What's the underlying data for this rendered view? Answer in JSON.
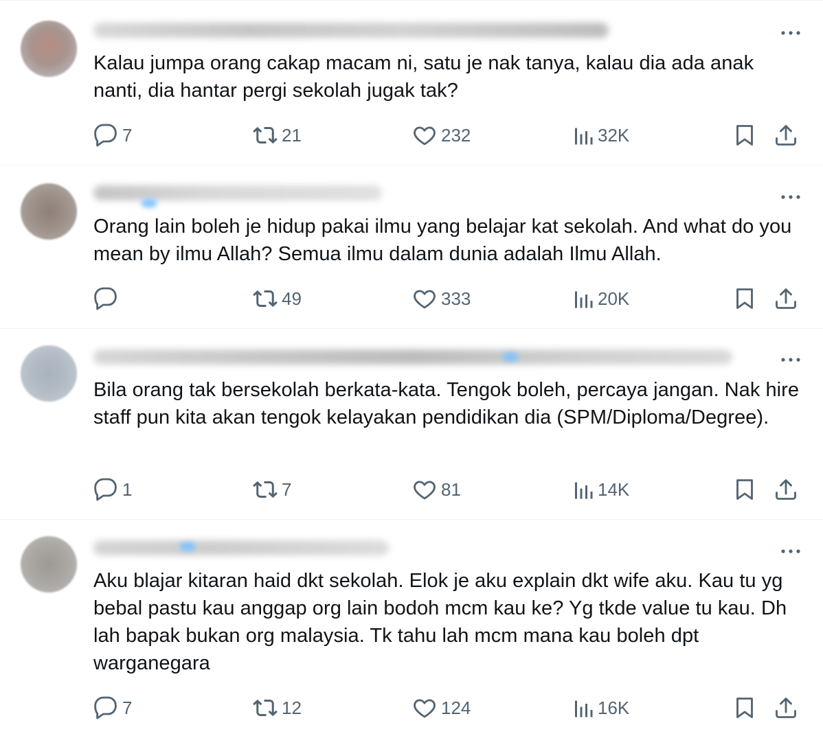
{
  "colors": {
    "text": "#0f1419",
    "secondary": "#536471",
    "divider": "#eff3f4"
  },
  "icons": {
    "reply": "reply-icon",
    "retweet": "retweet-icon",
    "like": "heart-icon",
    "views": "views-icon",
    "bookmark": "bookmark-icon",
    "share": "share-icon",
    "more": "more-icon"
  },
  "tweets": [
    {
      "text": "Kalau jumpa orang cakap macam ni, satu je nak tanya, kalau dia ada anak nanti, dia hantar pergi sekolah jugak tak?",
      "replies": "7",
      "retweets": "21",
      "likes": "232",
      "views": "32K"
    },
    {
      "text": "Orang lain boleh je hidup pakai ilmu yang belajar kat sekolah. And what do you mean by ilmu Allah? Semua ilmu dalam dunia adalah Ilmu Allah.",
      "replies": "",
      "retweets": "49",
      "likes": "333",
      "views": "20K"
    },
    {
      "text": "Bila orang tak bersekolah berkata-kata. Tengok boleh, percaya jangan. Nak hire staff pun kita akan tengok kelayakan pendidikan dia (SPM/Diploma/Degree).",
      "replies": "1",
      "retweets": "7",
      "likes": "81",
      "views": "14K"
    },
    {
      "text": "Aku blajar kitaran haid dkt sekolah. Elok je aku explain dkt wife aku. Kau tu yg bebal pastu kau anggap org lain bodoh mcm kau ke? Yg tkde value tu kau. Dh lah bapak bukan org malaysia. Tk tahu lah mcm mana kau boleh dpt warganegara",
      "replies": "7",
      "retweets": "12",
      "likes": "124",
      "views": "16K"
    }
  ]
}
